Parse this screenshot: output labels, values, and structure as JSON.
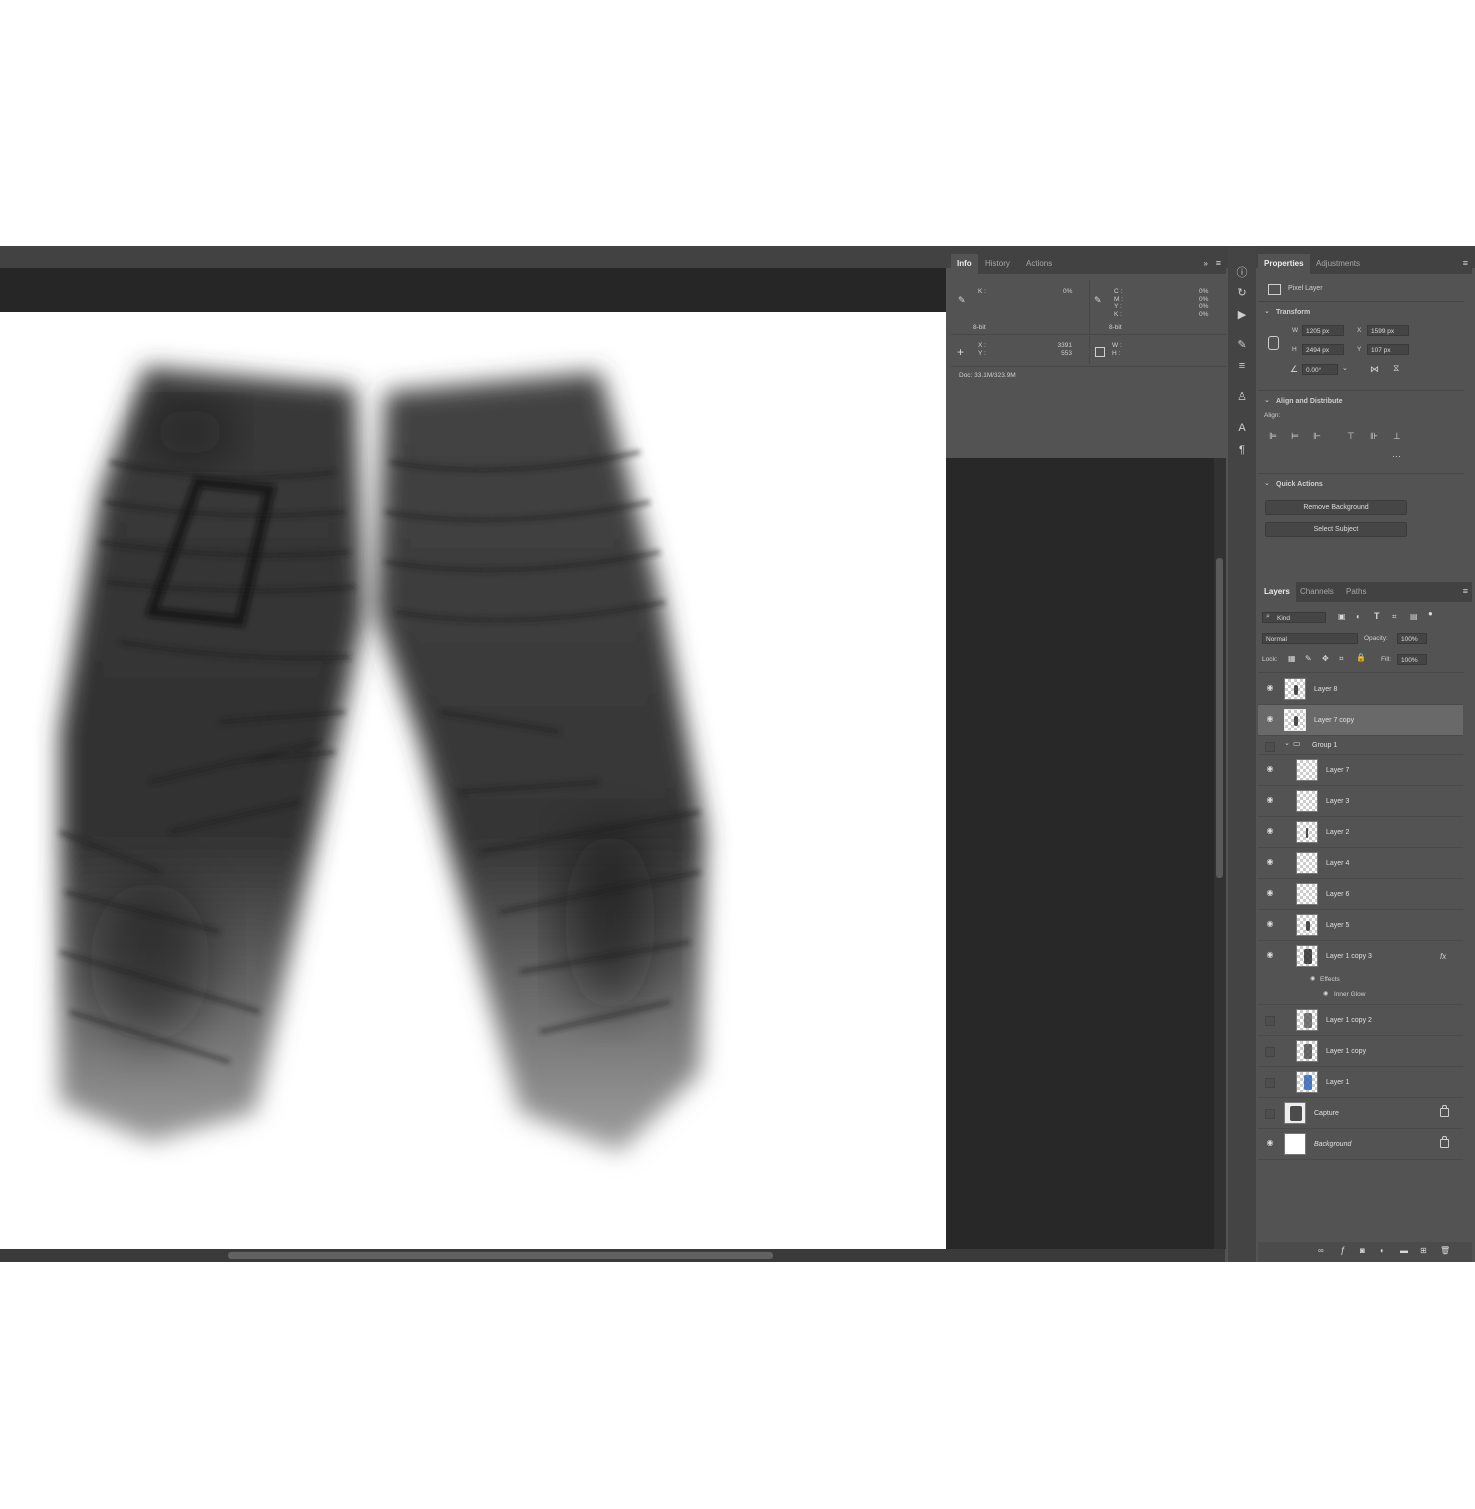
{
  "info_panel": {
    "tabs": [
      "Info",
      "History",
      "Actions"
    ],
    "left_readout": {
      "k_label": "K :",
      "k_value": "0%",
      "bit_depth": "8-bit"
    },
    "right_readout": {
      "labels": [
        "C :",
        "M :",
        "Y :",
        "K :"
      ],
      "values": [
        "0%",
        "0%",
        "0%",
        "0%"
      ],
      "bit_depth": "8-bit"
    },
    "coords": {
      "x_label": "X :",
      "y_label": "Y :",
      "x_value": "3391",
      "y_value": "553",
      "w_label": "W :",
      "h_label": "H :"
    },
    "doc_size": "Doc: 33.1M/323.9M"
  },
  "properties_panel": {
    "tabs": [
      "Properties",
      "Adjustments"
    ],
    "layer_type": "Pixel Layer",
    "transform": {
      "title": "Transform",
      "w_label": "W",
      "w_value": "1205 px",
      "h_label": "H",
      "h_value": "2494 px",
      "x_label": "X",
      "x_value": "1599 px",
      "y_label": "Y",
      "y_value": "107 px",
      "angle_value": "0.00°"
    },
    "align": {
      "title": "Align and Distribute",
      "align_label": "Align:"
    },
    "quick_actions": {
      "title": "Quick Actions",
      "remove_bg": "Remove Background",
      "select_subject": "Select Subject"
    }
  },
  "layers_panel": {
    "tabs": [
      "Layers",
      "Channels",
      "Paths"
    ],
    "filter_kind": "Kind",
    "blend_mode": "Normal",
    "opacity_label": "Opacity:",
    "opacity_value": "100%",
    "lock_label": "Lock:",
    "fill_label": "Fill:",
    "fill_value": "100%",
    "fx_label": "fx",
    "effects_label": "Effects",
    "inner_glow_label": "Inner Glow",
    "layers": [
      {
        "name": "Layer 8",
        "visible": true,
        "selected": false
      },
      {
        "name": "Layer 7 copy",
        "visible": true,
        "selected": true
      },
      {
        "name": "Group 1",
        "visible": false,
        "selected": false
      },
      {
        "name": "Layer 7",
        "visible": true,
        "selected": false
      },
      {
        "name": "Layer 3",
        "visible": true,
        "selected": false
      },
      {
        "name": "Layer 2",
        "visible": true,
        "selected": false
      },
      {
        "name": "Layer 4",
        "visible": true,
        "selected": false
      },
      {
        "name": "Layer 6",
        "visible": true,
        "selected": false
      },
      {
        "name": "Layer 5",
        "visible": true,
        "selected": false
      },
      {
        "name": "Layer 1 copy 3",
        "visible": true,
        "selected": false
      },
      {
        "name": "Layer 1 copy 2",
        "visible": false,
        "selected": false
      },
      {
        "name": "Layer 1 copy",
        "visible": false,
        "selected": false
      },
      {
        "name": "Layer 1",
        "visible": false,
        "selected": false
      },
      {
        "name": "Capture",
        "visible": false,
        "selected": false
      },
      {
        "name": "Background",
        "visible": true,
        "selected": false
      }
    ]
  }
}
